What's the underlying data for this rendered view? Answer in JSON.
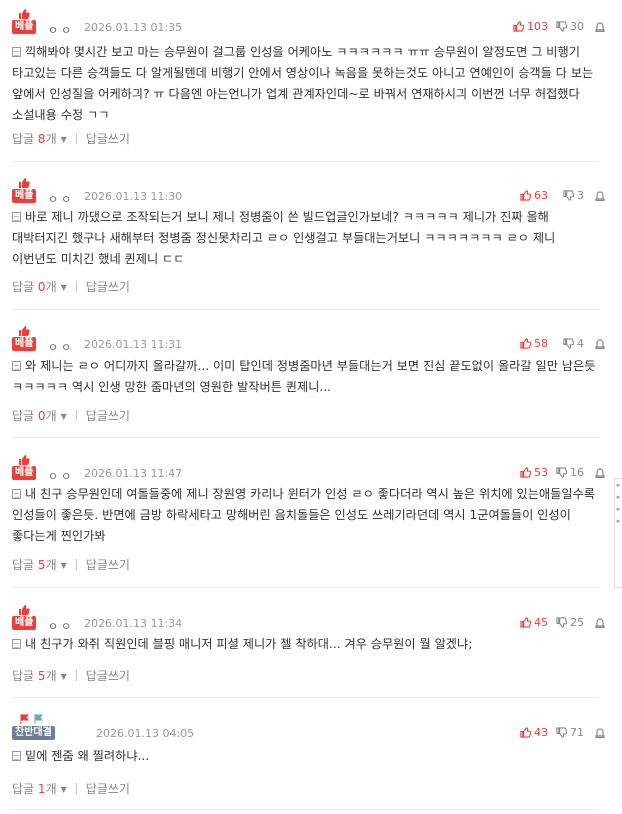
{
  "comments": [
    {
      "badge": "베플",
      "badge_type": "best",
      "author": "ㅇㅇ",
      "date": "2026.01.13 01:35",
      "likes": "103",
      "dislikes": "30",
      "text": "끽해봐야 몇시간 보고 마는 승무원이 걸그룹 인성을 어케아노 ㅋㅋㅋㅋㅋㅋ ㅠㅠ 승무원이 알정도면 그 비행기 타고있는 다른 승객들도 다 알게될텐데 비행기 안에서 영상이나 녹음을 못하는것도 아니고 연예인이 승객들 다 보는 앞에서 인성질을 어케하긔? ㅠ 다음엔 아는언니가 업계 관계자인데~로 바꿔서 연재하시긔 이번껀 너무 허접했다 소설내용 수정 ㄱㄱ",
      "reply_label": "답글",
      "reply_count": "8",
      "reply_unit": "개",
      "write_label": "답글쓰기"
    },
    {
      "badge": "베플",
      "badge_type": "best",
      "author": "ㅇㅇ",
      "date": "2026.01.13 11:30",
      "likes": "63",
      "dislikes": "3",
      "text": "바로 제니 까댔으로 조작되는거 보니 제니 정병줌이 쓴 빌드업글인가보네? ㅋㅋㅋㅋㅋ 제니가 진짜 올해 대박터지긴 했구나 새해부터 정병줌 정신못차리고 ㄹㅇ 인생걸고 부들대는거보니 ㅋㅋㅋㅋㅋㅋㅋ ㄹㅇ 제니 이번년도 미치긴 했네 퀸제니 ㄷㄷ",
      "reply_label": "답글",
      "reply_count": "0",
      "reply_unit": "개",
      "write_label": "답글쓰기"
    },
    {
      "badge": "베플",
      "badge_type": "best",
      "author": "ㅇㅇ",
      "date": "2026.01.13 11:31",
      "likes": "58",
      "dislikes": "4",
      "text": "와 제니는 ㄹㅇ 어디까지 올라갈까... 이미 탑인데 정병줌마년 부들대는거 보면 진심 끝도없이 올라갈 일만 남은듯 ㅋㅋㅋㅋㅋ 역시 인생 망한 줌마년의 영원한 발작버튼 퀸제니...",
      "reply_label": "답글",
      "reply_count": "0",
      "reply_unit": "개",
      "write_label": "답글쓰기"
    },
    {
      "badge": "베플",
      "badge_type": "best",
      "author": "ㅇㅇ",
      "date": "2026.01.13 11:47",
      "likes": "53",
      "dislikes": "16",
      "text": "내 친구 승무원인데 여돌들중에 제니 장원영 카리나 윈터가 인성 ㄹㅇ 좋다더라 역시 높은 위치에 있는애들일수록 인성들이 좋은듯. 반면에 금방 하락세타고 망해버린 음치돌들은 인성도 쓰레기라던데 역시 1군여돌들이 인성이 좋다는게 찐인가봐",
      "reply_label": "답글",
      "reply_count": "5",
      "reply_unit": "개",
      "write_label": "답글쓰기"
    },
    {
      "badge": "베플",
      "badge_type": "best",
      "author": "ㅇㅇ",
      "date": "2026.01.13 11:34",
      "likes": "45",
      "dislikes": "25",
      "text": "내 친구가 와쥐 직원인데 블핑 매니저 피셜 제니가 젤 착하대... 겨우 승무원이 뭘 알겠냐;",
      "reply_label": "답글",
      "reply_count": "5",
      "reply_unit": "개",
      "write_label": "답글쓰기"
    },
    {
      "badge": "찬반대결",
      "badge_type": "debate",
      "author": "",
      "date": "2026.01.13 04:05",
      "likes": "43",
      "dislikes": "71",
      "text": "밑에 젠줌 왜 찔려하냐...",
      "reply_label": "답글",
      "reply_count": "1",
      "reply_unit": "개",
      "write_label": "답글쓰기"
    }
  ],
  "colors": {
    "accent_red": "#e8413c",
    "debate_badge": "#6d7f96",
    "muted": "#999999"
  },
  "icons": {
    "badge": "thumbs-up-icon",
    "likes": "thumbs-up-icon",
    "dislikes": "thumbs-down-icon",
    "report": "siren-icon",
    "text": "document-icon",
    "debate": "flag-icon"
  }
}
